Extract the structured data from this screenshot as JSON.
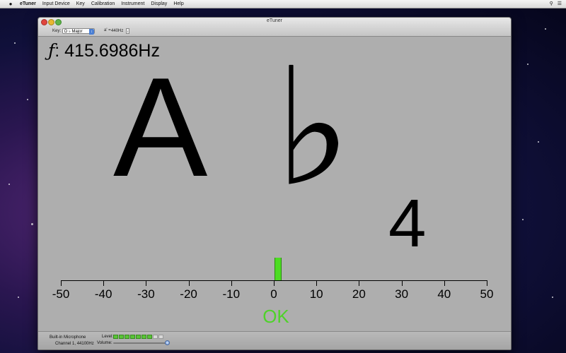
{
  "menubar": {
    "app": "eTuner",
    "items": [
      "Input Device",
      "Key",
      "Calibration",
      "Instrument",
      "Display",
      "Help"
    ]
  },
  "window": {
    "title": "eTuner",
    "key_label": "Key:",
    "key_value": "D ♭ Major",
    "pitch_label": "a' =",
    "pitch_value": "440Hz"
  },
  "readout": {
    "frequency_symbol": "ƒ",
    "frequency": ": 415.6986Hz",
    "note": "A",
    "accidental": "♭",
    "octave": "4"
  },
  "meter": {
    "ticks": [
      "-50",
      "-40",
      "-30",
      "-20",
      "-10",
      "0",
      "10",
      "20",
      "30",
      "40",
      "50"
    ],
    "deviation_cents": 1,
    "status": "OK",
    "needle_color": "#4cdc22",
    "ok_color": "#4fd22a"
  },
  "status": {
    "device": "Built-in Microphone",
    "channel": "Channel 1, 44100Hz",
    "level_label": "Level:",
    "volume_label": "Volume:",
    "level_segments_on": 7,
    "level_segments_total": 9,
    "volume_fraction": 0.95
  }
}
